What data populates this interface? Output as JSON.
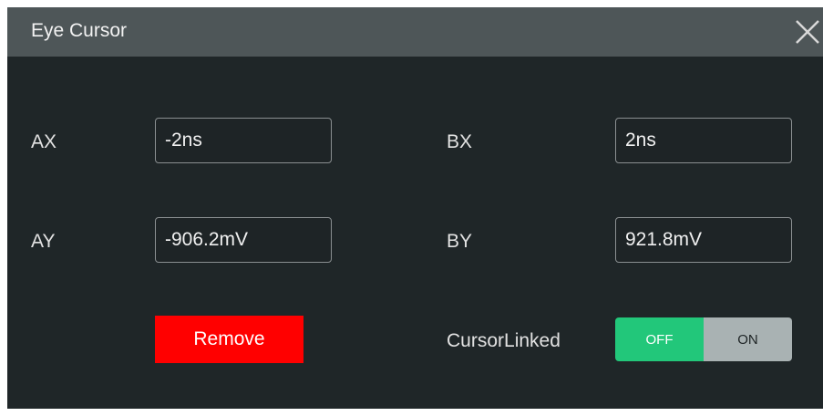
{
  "dialog": {
    "title": "Eye Cursor",
    "close_icon": "close-icon"
  },
  "fields": {
    "ax": {
      "label": "AX",
      "value": "-2ns"
    },
    "bx": {
      "label": "BX",
      "value": "2ns"
    },
    "ay": {
      "label": "AY",
      "value": "-906.2mV"
    },
    "by": {
      "label": "BY",
      "value": "921.8mV"
    }
  },
  "remove_button": {
    "label": "Remove",
    "color": "#ff0000"
  },
  "cursor_linked": {
    "label": "CursorLinked",
    "off_label": "OFF",
    "on_label": "ON",
    "state": "OFF",
    "active_color": "#22c77a"
  }
}
